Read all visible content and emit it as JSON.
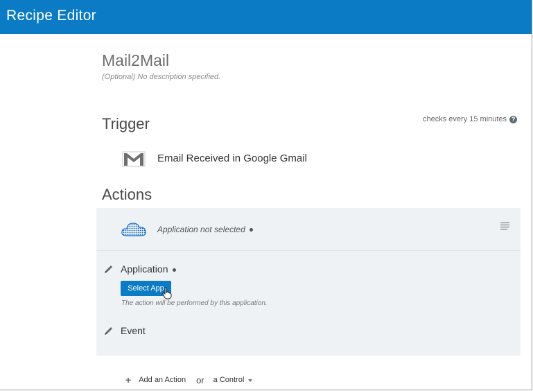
{
  "app": {
    "title": "Recipe Editor"
  },
  "recipe": {
    "name": "Mail2Mail",
    "description": "(Optional) No description specified."
  },
  "trigger": {
    "title": "Trigger",
    "checks": "checks every 15 minutes",
    "help_icon": "?",
    "label": "Email Received in Google Gmail",
    "icon": "gmail-icon"
  },
  "actions": {
    "title": "Actions",
    "app_status": "Application not selected",
    "application_label": "Application",
    "select_app_label": "Select App",
    "application_hint": "The action will be performed by this application.",
    "event_label": "Event"
  },
  "footer": {
    "add_action": "Add an Action",
    "or": "or",
    "control": "a Control"
  },
  "colors": {
    "topbar": "#0a7bc4",
    "panel": "#eef2f5",
    "button": "#0a7bc4"
  }
}
